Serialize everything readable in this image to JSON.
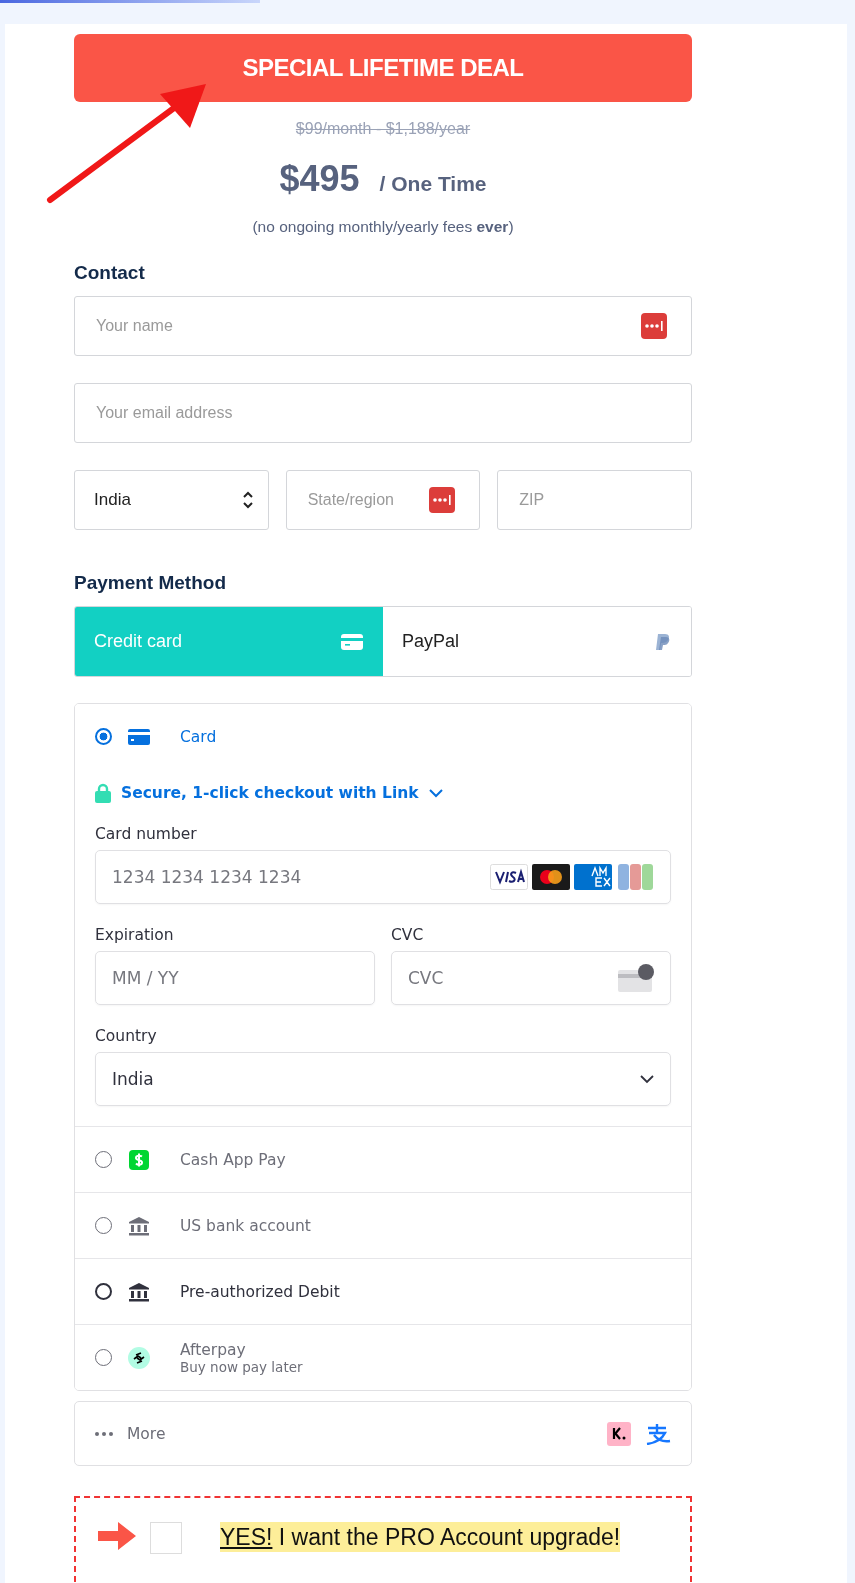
{
  "deal_button": {
    "label": "SPECIAL LIFETIME DEAL"
  },
  "old_price": "$99/month - $1,188/year",
  "price": {
    "amount": "$495",
    "period": "/ One Time"
  },
  "price_note": "(no ongoing monthly/yearly fees **ever**)",
  "contact": {
    "heading": "Contact",
    "name_field": {
      "placeholder": "Your name"
    },
    "email_field": {
      "placeholder": "Your email address"
    },
    "country_select": {
      "value": "India"
    },
    "state_field": {
      "placeholder": "State/region"
    },
    "zip_field": {
      "placeholder": "ZIP"
    }
  },
  "payment": {
    "heading": "Payment Method",
    "tabs": [
      {
        "label": "Credit card",
        "kind": "card",
        "selected": true
      },
      {
        "label": "PayPal",
        "kind": "paypal",
        "selected": false
      }
    ],
    "methods": [
      {
        "label": "Card",
        "kind": "card",
        "selected": true,
        "expanded": true
      },
      {
        "label": "Cash App Pay",
        "kind": "cashapp",
        "selected": false,
        "expanded": false
      },
      {
        "label": "US bank account",
        "kind": "bank",
        "selected": false,
        "expanded": false
      },
      {
        "label": "Pre-authorized Debit",
        "kind": "bank",
        "selected": false,
        "expanded": false,
        "hovered": true
      },
      {
        "label": "Afterpay",
        "subtitle": "Buy now pay later",
        "kind": "afterpay",
        "selected": false,
        "expanded": false
      }
    ],
    "card_form": {
      "link_label": "Secure, 1-click checkout with Link",
      "card_number": {
        "label": "Card number",
        "placeholder": "1234 1234 1234 1234"
      },
      "expiration": {
        "label": "Expiration",
        "placeholder": "MM / YY"
      },
      "cvc": {
        "label": "CVC",
        "placeholder": "CVC"
      },
      "country": {
        "label": "Country",
        "value": "India"
      }
    },
    "more": {
      "label": "More"
    }
  },
  "upgrade": {
    "emphasis": "YES!",
    "text": "I want the PRO Account upgrade!",
    "checked": false
  }
}
